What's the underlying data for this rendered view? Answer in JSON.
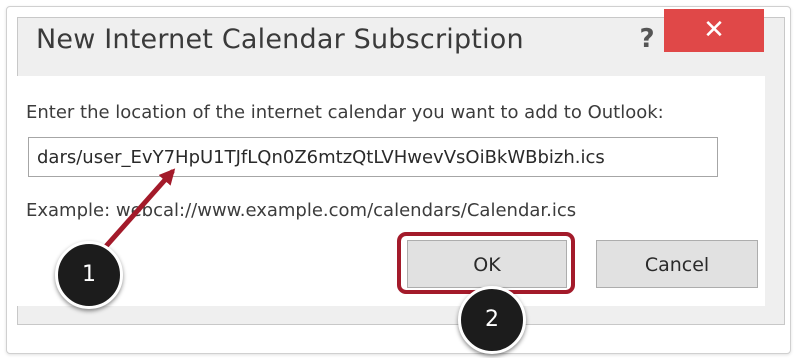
{
  "dialog": {
    "title": "New Internet Calendar Subscription",
    "help_label": "?",
    "close_label": "✕",
    "prompt": "Enter the location of the internet calendar you want to add to Outlook:",
    "url_value": "dars/user_EvY7HpU1TJfLQn0Z6mtzQtLVHwevVsOiBkWBbizh.ics",
    "example_text": "Example: webcal://www.example.com/calendars/Calendar.ics",
    "ok_label": "OK",
    "cancel_label": "Cancel"
  },
  "annotations": {
    "step_1": "1",
    "step_2": "2",
    "highlight_color": "#a31a2a",
    "arrow_color": "#a31a2a"
  },
  "colors": {
    "close_button": "#e04848",
    "dialog_background": "#efefef"
  }
}
